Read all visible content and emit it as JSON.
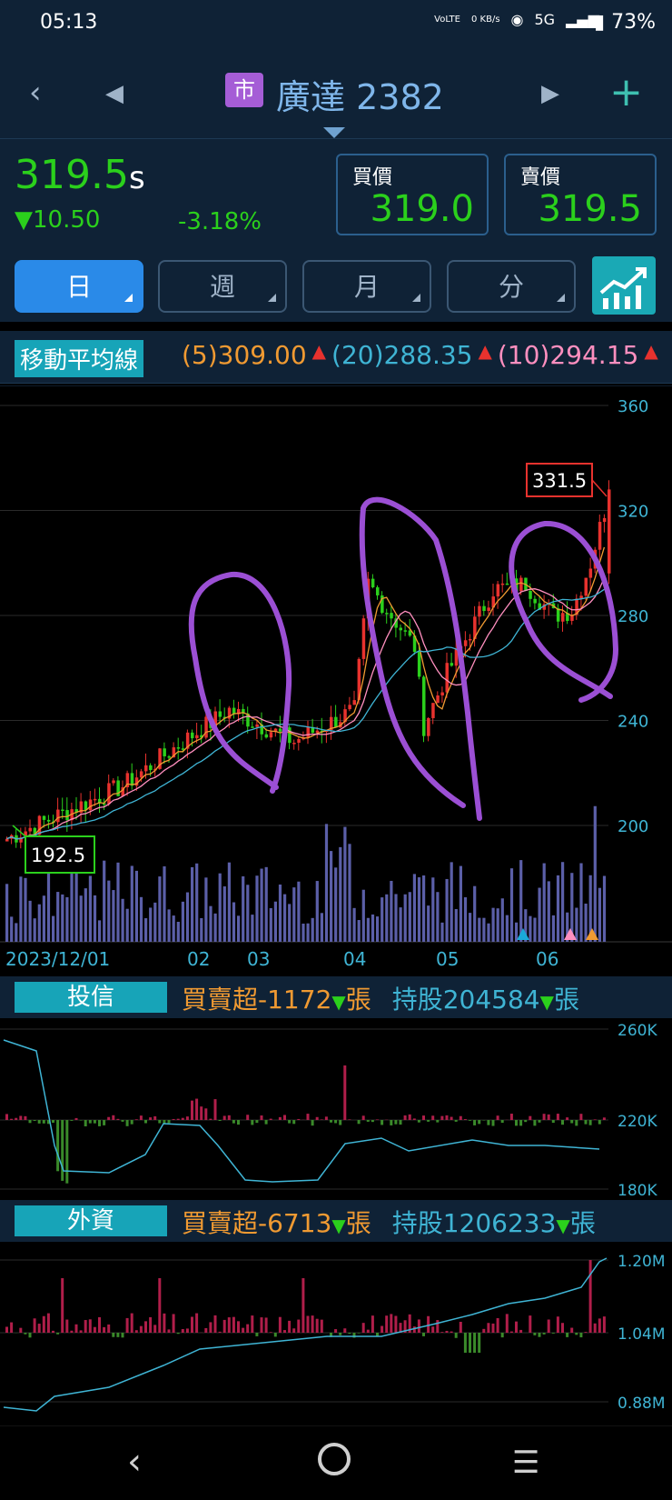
{
  "status_bar": {
    "time": "05:13",
    "volte": "VoLTE",
    "speed": "0 KB/s",
    "network": "5G",
    "battery": "73%"
  },
  "header": {
    "market_badge": "市",
    "stock_name": "廣達",
    "stock_code": "2382"
  },
  "quote": {
    "price": "319.5",
    "price_suffix": "s",
    "change": "▼10.50",
    "change_pct": "-3.18%",
    "bid_label": "買價",
    "bid": "319.0",
    "ask_label": "賣價",
    "ask": "319.5"
  },
  "tabs": [
    {
      "label": "日",
      "active": true
    },
    {
      "label": "週",
      "active": false
    },
    {
      "label": "月",
      "active": false
    },
    {
      "label": "分",
      "active": false
    }
  ],
  "ma_bar": {
    "label": "移動平均線",
    "ma5": "(5)309.00",
    "ma20": "(20)288.35",
    "ma10": "(10)294.15",
    "colors": {
      "ma5": "#f09a32",
      "ma20": "#3fb4d4",
      "ma10": "#ff8fbf"
    }
  },
  "chart_data": [
    {
      "type": "candlestick",
      "y_ticks": [
        "360",
        "320",
        "280",
        "240",
        "200"
      ],
      "ylim": [
        190,
        360
      ],
      "x_ticks": [
        "2023/12/01",
        "02",
        "03",
        "04",
        "05",
        "06"
      ],
      "annotations": {
        "high": "331.5",
        "low": "192.5"
      },
      "volume_markers": [
        "#1aa9d8",
        "#ff8fbf",
        "#f09a32"
      ]
    },
    {
      "type": "bar",
      "title": "投信",
      "y_ticks": [
        "260K",
        "220K",
        "180K"
      ]
    },
    {
      "type": "bar",
      "title": "外資",
      "y_ticks": [
        "1.20M",
        "1.04M",
        "0.88M"
      ]
    }
  ],
  "trust": {
    "label": "投信",
    "net_label": "買賣超",
    "net_value": "-1172",
    "unit": "張",
    "hold_label": "持股",
    "hold_value": "204584",
    "unit2": "張"
  },
  "foreign": {
    "label": "外資",
    "net_label": "買賣超",
    "net_value": "-6713",
    "unit": "張",
    "hold_label": "持股",
    "hold_value": "1206233",
    "unit2": "張"
  }
}
